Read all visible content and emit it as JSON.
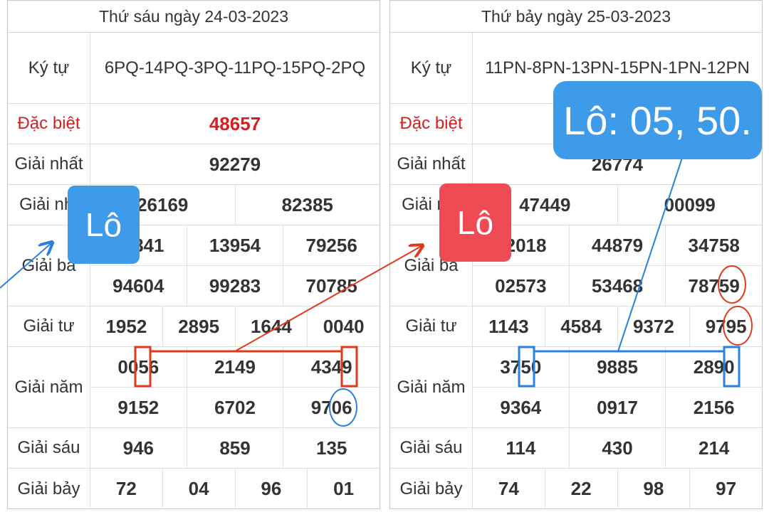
{
  "left": {
    "title": "Thứ sáu ngày 24-03-2023",
    "rows": {
      "kytu": {
        "label": "Ký tự",
        "value": "6PQ-14PQ-3PQ-11PQ-15PQ-2PQ"
      },
      "dacbiet": {
        "label": "Đặc biệt",
        "value": "48657"
      },
      "nhat": {
        "label": "Giải nhất",
        "values": [
          "92279"
        ]
      },
      "nhi": {
        "label": "Giải nhì",
        "values": [
          "26169",
          "82385"
        ]
      },
      "ba": {
        "label": "Giải ba",
        "values": [
          "12841",
          "13954",
          "79256",
          "94604",
          "99283",
          "70785"
        ]
      },
      "tu": {
        "label": "Giải tư",
        "values": [
          "1952",
          "2895",
          "1644",
          "0040"
        ]
      },
      "nam": {
        "label": "Giải năm",
        "values": [
          "0056",
          "2149",
          "4349",
          "9152",
          "6702",
          "9706"
        ]
      },
      "sau": {
        "label": "Giải sáu",
        "values": [
          "946",
          "859",
          "135"
        ]
      },
      "bay": {
        "label": "Giải bảy",
        "values": [
          "72",
          "04",
          "96",
          "01"
        ]
      }
    }
  },
  "right": {
    "title": "Thứ bảy ngày 25-03-2023",
    "rows": {
      "kytu": {
        "label": "Ký tự",
        "value": "11PN-8PN-13PN-15PN-1PN-12PN"
      },
      "dacbiet": {
        "label": "Đặc biệt",
        "value": ""
      },
      "nhat": {
        "label": "Giải nhất",
        "values": [
          "26774"
        ]
      },
      "nhi": {
        "label": "Giải nhì",
        "values": [
          "47449",
          "00099"
        ]
      },
      "ba": {
        "label": "Giải ba",
        "values": [
          "72018",
          "44879",
          "34758",
          "02573",
          "53468",
          "78759"
        ]
      },
      "tu": {
        "label": "Giải tư",
        "values": [
          "1143",
          "4584",
          "9372",
          "9795"
        ]
      },
      "nam": {
        "label": "Giải năm",
        "values": [
          "3750",
          "9885",
          "2890",
          "9364",
          "0917",
          "2156"
        ]
      },
      "sau": {
        "label": "Giải sáu",
        "values": [
          "114",
          "430",
          "214"
        ]
      },
      "bay": {
        "label": "Giải bảy",
        "values": [
          "74",
          "22",
          "98",
          "97"
        ]
      }
    }
  },
  "annotations": {
    "badge_blue": "Lô",
    "badge_red": "Lô",
    "callout": "Lô: 05, 50.",
    "colors": {
      "blue": "#3d9be9",
      "red": "#ef4b55",
      "arrow_red": "#e03a1a",
      "arrow_blue": "#2a7fe0"
    }
  }
}
